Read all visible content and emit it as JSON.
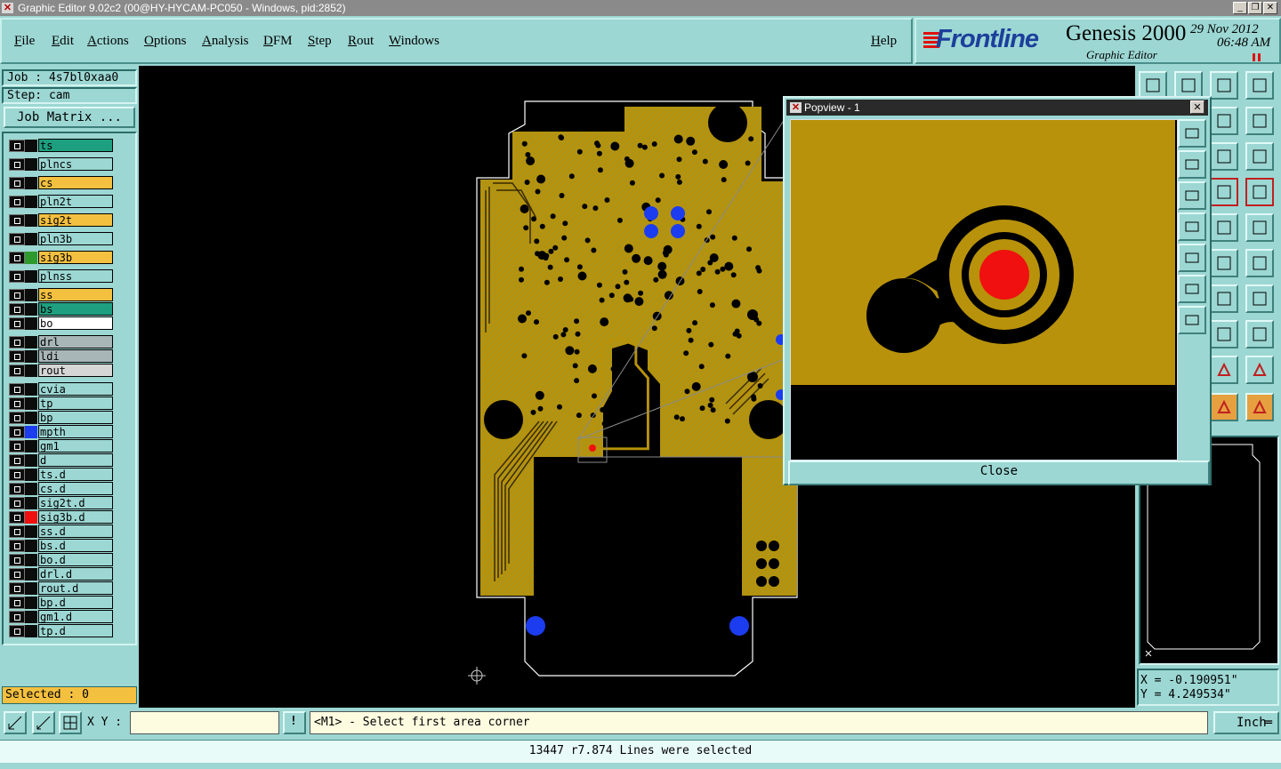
{
  "window": {
    "title": "Graphic Editor 9.02c2 (00@HY-HYCAM-PC050 - Windows, pid:2852)"
  },
  "menu": [
    "File",
    "Edit",
    "Actions",
    "Options",
    "Analysis",
    "DFM",
    "Step",
    "Rout",
    "Windows"
  ],
  "help_label": "Help",
  "brand": {
    "logo": "Frontline",
    "product": "Genesis 2000",
    "subtitle": "Graphic Editor",
    "date": "29 Nov 2012",
    "time": "06:48 AM"
  },
  "job": {
    "job_line": "Job : 4s7bl0xaa0",
    "step_line": "Step: cam",
    "matrix_button": "Job Matrix ..."
  },
  "layers": [
    {
      "name": "ts",
      "color": "#1ea080",
      "swatch": ""
    },
    {
      "name": "plncs",
      "color": "#9cd7d3",
      "swatch": ""
    },
    {
      "name": "cs",
      "color": "#f4c040",
      "swatch": ""
    },
    {
      "name": "pln2t",
      "color": "#9cd7d3",
      "swatch": ""
    },
    {
      "name": "sig2t",
      "color": "#f4c040",
      "swatch": ""
    },
    {
      "name": "pln3b",
      "color": "#9cd7d3",
      "swatch": ""
    },
    {
      "name": "sig3b",
      "color": "#f4c040",
      "swatch": "#2e9a2e"
    },
    {
      "name": "plnss",
      "color": "#9cd7d3",
      "swatch": ""
    },
    {
      "name": "ss",
      "color": "#f4c040",
      "swatch": ""
    },
    {
      "name": "bs",
      "color": "#1ea080",
      "swatch": ""
    },
    {
      "name": "bo",
      "color": "#ffffff",
      "swatch": ""
    },
    {
      "name": "drl",
      "color": "#a9b6b8",
      "swatch": ""
    },
    {
      "name": "ldi",
      "color": "#a9b6b8",
      "swatch": ""
    },
    {
      "name": "rout",
      "color": "#d6d6d6",
      "swatch": ""
    },
    {
      "name": "cvia",
      "color": "#9cd7d3",
      "swatch": ""
    },
    {
      "name": "tp",
      "color": "#9cd7d3",
      "swatch": ""
    },
    {
      "name": "bp",
      "color": "#9cd7d3",
      "swatch": ""
    },
    {
      "name": "mpth",
      "color": "#9cd7d3",
      "swatch": "#1c3cf0"
    },
    {
      "name": "gm1",
      "color": "#9cd7d3",
      "swatch": ""
    },
    {
      "name": "d",
      "color": "#9cd7d3",
      "swatch": ""
    },
    {
      "name": "ts.d",
      "color": "#9cd7d3",
      "swatch": ""
    },
    {
      "name": "cs.d",
      "color": "#9cd7d3",
      "swatch": ""
    },
    {
      "name": "sig2t.d",
      "color": "#9cd7d3",
      "swatch": ""
    },
    {
      "name": "sig3b.d",
      "color": "#9cd7d3",
      "swatch": "#f01010"
    },
    {
      "name": "ss.d",
      "color": "#9cd7d3",
      "swatch": ""
    },
    {
      "name": "bs.d",
      "color": "#9cd7d3",
      "swatch": ""
    },
    {
      "name": "bo.d",
      "color": "#9cd7d3",
      "swatch": ""
    },
    {
      "name": "drl.d",
      "color": "#9cd7d3",
      "swatch": ""
    },
    {
      "name": "rout.d",
      "color": "#9cd7d3",
      "swatch": ""
    },
    {
      "name": "bp.d",
      "color": "#9cd7d3",
      "swatch": ""
    },
    {
      "name": "gm1.d",
      "color": "#9cd7d3",
      "swatch": ""
    },
    {
      "name": "tp.d",
      "color": "#9cd7d3",
      "swatch": ""
    }
  ],
  "selected_text": "Selected : 0",
  "popview": {
    "title": "Popview - 1",
    "close_label": "Close"
  },
  "coords": {
    "x": "X = -0.190951\"",
    "y": "Y = 4.249534\""
  },
  "bottom": {
    "xy_label": "X Y :",
    "xy_value": "",
    "prompt": "<M1> - Select first area corner",
    "unit": "Inch",
    "status": "13447 r7.874 Lines were selected"
  },
  "colors": {
    "copper": "#b8920a",
    "panel": "#9cd7d3",
    "via_blue": "#1c3cf0",
    "pad_red": "#f01010"
  },
  "icons": [
    "hex-icon",
    "rotate-icon",
    "cross-icon",
    "move-icon",
    "pan-icon",
    "question-icon",
    "zoom-icon",
    "select-icon"
  ]
}
